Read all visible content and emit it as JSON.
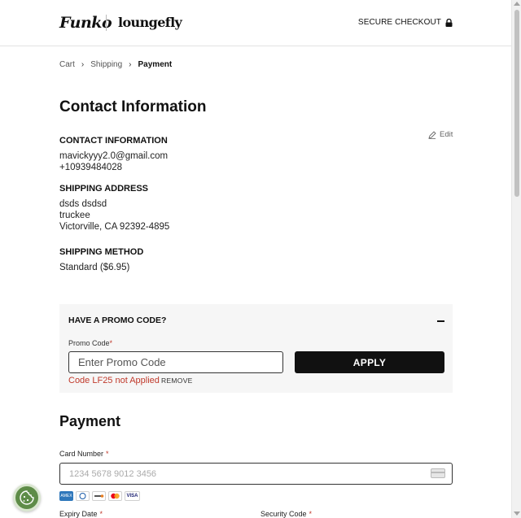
{
  "header": {
    "brand_primary": "Funko",
    "brand_secondary": "loungefly",
    "secure_label": "SECURE CHECKOUT"
  },
  "breadcrumb": {
    "items": [
      "Cart",
      "Shipping",
      "Payment"
    ],
    "active_index": 2
  },
  "contact": {
    "page_title": "Contact Information",
    "edit_label": "Edit",
    "contact_title": "CONTACT INFORMATION",
    "email": "mavickyyy2.0@gmail.com",
    "phone": "+10939484028",
    "shipping_title": "SHIPPING ADDRESS",
    "address_lines": [
      "dsds dsdsd",
      "truckee",
      "Victorville, CA 92392-4895"
    ],
    "method_title": "SHIPPING METHOD",
    "method_value": "Standard ($6.95)"
  },
  "promo": {
    "title": "HAVE A PROMO CODE?",
    "label": "Promo Code",
    "required_mark": "*",
    "placeholder": "Enter Promo Code",
    "apply_label": "APPLY",
    "error_text": "Code LF25 not Applied",
    "remove_label": "REMOVE"
  },
  "payment": {
    "title": "Payment",
    "card_label": "Card Number",
    "required_mark": "*",
    "card_placeholder": "1234 5678 9012 3456",
    "card_brands": [
      "amex",
      "diners",
      "discover",
      "mastercard",
      "visa"
    ],
    "brand_text": {
      "amex": "AMEX",
      "visa": "VISA"
    },
    "expiry_label": "Expiry Date",
    "security_label": "Security Code"
  },
  "colors": {
    "error": "#c0392b",
    "button": "#111111",
    "promo_bg": "#f6f6f6",
    "cookie_button": "#5e8c48"
  }
}
